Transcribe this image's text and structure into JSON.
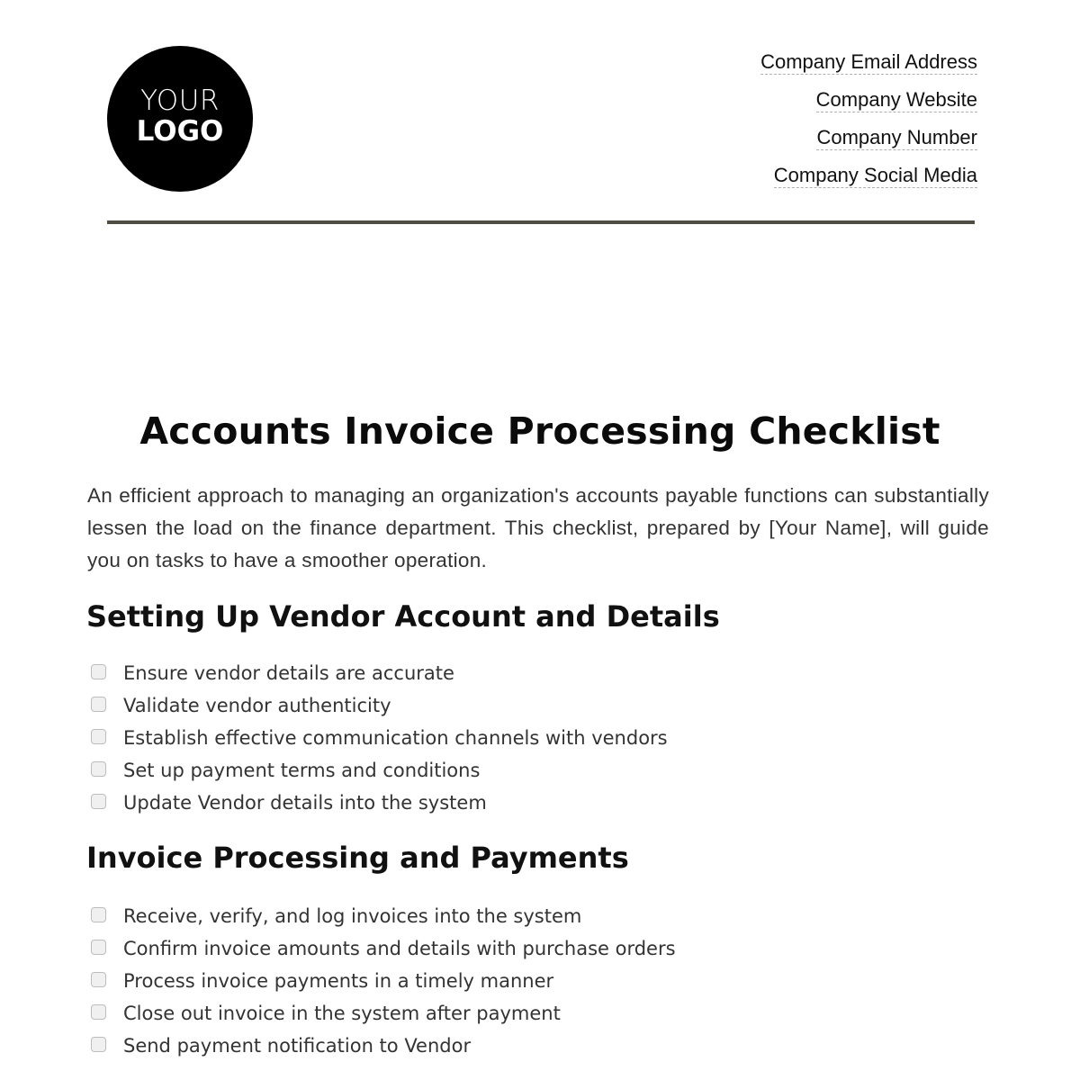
{
  "header": {
    "logo": {
      "line1": "YOUR",
      "line2": "LOGO"
    },
    "contact": [
      "Company Email Address",
      "Company Website",
      "Company Number",
      "Company Social Media"
    ]
  },
  "document": {
    "title": "Accounts Invoice Processing Checklist",
    "intro": "An efficient approach to managing an organization's accounts payable functions can substantially lessen the load on the finance department. This checklist, prepared by [Your Name], will guide you on tasks to have a smoother operation.",
    "sections": [
      {
        "heading": "Setting Up Vendor Account and Details",
        "items": [
          {
            "label": "Ensure vendor details are accurate",
            "checked": false
          },
          {
            "label": "Validate vendor authenticity",
            "checked": false
          },
          {
            "label": "Establish effective communication channels with vendors",
            "checked": false
          },
          {
            "label": "Set up payment terms and conditions",
            "checked": false
          },
          {
            "label": "Update Vendor details into the system",
            "checked": false
          }
        ]
      },
      {
        "heading": "Invoice Processing and Payments",
        "items": [
          {
            "label": "Receive, verify, and log invoices into the system",
            "checked": false
          },
          {
            "label": "Confirm invoice amounts and details with purchase orders",
            "checked": false
          },
          {
            "label": "Process invoice payments in a timely manner",
            "checked": false
          },
          {
            "label": "Close out invoice in the system after payment",
            "checked": false
          },
          {
            "label": "Send payment notification to Vendor",
            "checked": false
          }
        ]
      }
    ]
  }
}
